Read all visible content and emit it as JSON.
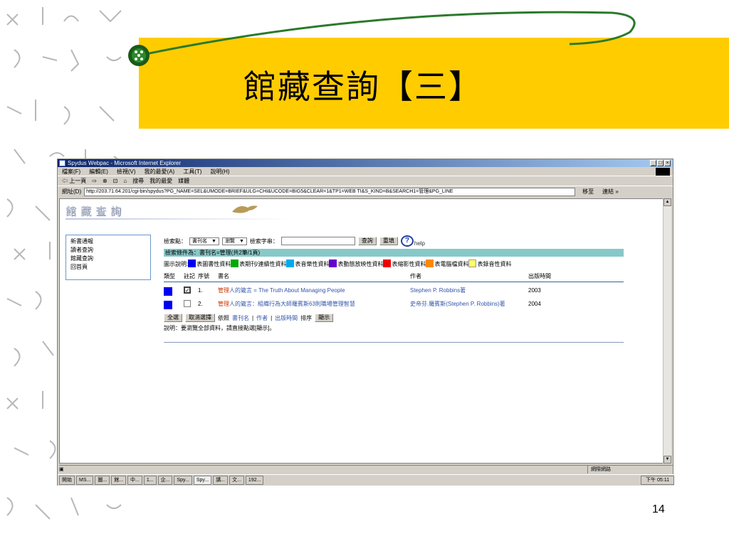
{
  "slide": {
    "title": "館藏查詢【三】",
    "page_number": "14"
  },
  "window": {
    "title": "Spydus Webpac - Microsoft Internet Explorer",
    "controls": [
      "_",
      "□",
      "×"
    ]
  },
  "menu": [
    "檔案(F)",
    "編輯(E)",
    "檢視(V)",
    "我的最愛(A)",
    "工具(T)",
    "說明(H)"
  ],
  "toolbar": [
    "⇦ 上一頁",
    "⇨",
    "⊗",
    "⊡",
    "⌂",
    "搜尋",
    "我的最愛",
    "媒體"
  ],
  "address": {
    "label": "網址(D)",
    "url": "http://203.71.64.201/cgi-bin/spydus?PG_NAME=SEL&UMODE=BRIEF&ULG=CHI&UCODE=BIG5&CLEAR=1&TP1=WEB TI&S_KIND=B&SEARCH1=管理&PG_LINE",
    "go": "移至",
    "links": "連結 »"
  },
  "page": {
    "banner": "館藏查詢",
    "left_nav": [
      "新書通報",
      "讀者查詢",
      "館藏查詢",
      "回首頁"
    ],
    "search": {
      "point_label": "檢索點：",
      "point_value": "書刊名",
      "mode_value": "瀏覽",
      "string_label": "檢索字串：",
      "query_btn": "查詢",
      "reset_btn": "重填",
      "help": "help"
    },
    "condition": "檢索條件為：書刊名=管理(共2筆/1頁)",
    "legend": {
      "prefix": "圖示說明:",
      "items": [
        {
          "label": "表圖書性資料",
          "color": "#0000ee"
        },
        {
          "label": "表期刊/連續性資料",
          "color": "#00aa00"
        },
        {
          "label": "表音樂性資料",
          "color": "#00aaee"
        },
        {
          "label": "表動態放映性資料",
          "color": "#6600cc"
        },
        {
          "label": "表縮影性資料",
          "color": "#ee0000"
        },
        {
          "label": "表電腦檔資料",
          "color": "#ff8800"
        },
        {
          "label": "表錄音性資料",
          "color": "#ffff66"
        }
      ]
    },
    "table": {
      "headers": [
        "類型",
        "註記",
        "序號",
        "書名",
        "作者",
        "出版時間"
      ],
      "rows": [
        {
          "checked": true,
          "no": "1.",
          "title_hl": "管理",
          "title_rest": "人的箴言 = The Truth About Managing People",
          "author": "Stephen P. Robbins著",
          "year": "2003"
        },
        {
          "checked": false,
          "no": "2.",
          "title_hl": "管理",
          "title_rest": "人的箴言：組織行為大師羅賓斯63則職場管理智慧",
          "author": "史帝芬.羅賓斯(Stephen P. Robbins)著",
          "year": "2004"
        }
      ]
    },
    "actions": {
      "select_all": "全選",
      "cancel": "取消選擇",
      "by": "依照",
      "sort_title": "書刊名",
      "sort_author": "作者",
      "sort_year": "出版時間",
      "sort_label": "排序",
      "display": "顯示"
    },
    "note": "說明：要瀏覽全部資料，請直接點選[顯示]。"
  },
  "status": {
    "zone": "網際網路"
  },
  "taskbar": {
    "start": "開始",
    "items": [
      "MS...",
      "圖...",
      "館...",
      "中...",
      "1...",
      "企...",
      "Spy...",
      "Spy...",
      "講...",
      "文...",
      "192..."
    ],
    "clock": "下午 05:11"
  }
}
